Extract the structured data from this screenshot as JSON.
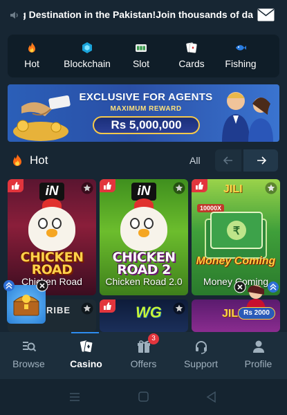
{
  "marquee": {
    "text": "Gaming Destination in the Pakistan!Join thousands of da"
  },
  "categories": [
    {
      "label": "Hot",
      "icon": "fire-icon"
    },
    {
      "label": "Blockchain",
      "icon": "blockchain-cube-icon"
    },
    {
      "label": "Slot",
      "icon": "slot-machine-icon"
    },
    {
      "label": "Cards",
      "icon": "playing-cards-icon"
    },
    {
      "label": "Fishing",
      "icon": "fish-icon"
    }
  ],
  "banner": {
    "line1": "EXCLUSIVE FOR AGENTS",
    "line2": "MAXIMUM REWARD",
    "amount": "Rs 5,000,000"
  },
  "section": {
    "title": "Hot",
    "all_label": "All"
  },
  "games": [
    {
      "name": "Chicken Road",
      "logo": "iN",
      "art_title": "CHICKEN ROAD"
    },
    {
      "name": "Chicken Road 2.0",
      "logo": "iN",
      "art_title": "CHICKEN ROAD 2"
    },
    {
      "name": "Money Coming",
      "logo": "JILI",
      "art_title": "Money Coming",
      "art_badge": "10000X"
    }
  ],
  "games_row2": [
    {
      "logo_text": "RIBE"
    },
    {
      "logo_text": "WG"
    },
    {
      "logo_text": "JILI",
      "badge": "Rs 2000"
    }
  ],
  "nav": [
    {
      "label": "Browse",
      "icon": "browse-search-icon"
    },
    {
      "label": "Casino",
      "icon": "casino-cards-icon",
      "active": true
    },
    {
      "label": "Offers",
      "icon": "gift-icon",
      "badge": "3"
    },
    {
      "label": "Support",
      "icon": "headset-icon"
    },
    {
      "label": "Profile",
      "icon": "user-icon"
    }
  ],
  "colors": {
    "background": "#172633",
    "accent_red": "#e2353d",
    "accent_blue": "#2e8df0",
    "nav_bg": "#1c2e3c"
  }
}
